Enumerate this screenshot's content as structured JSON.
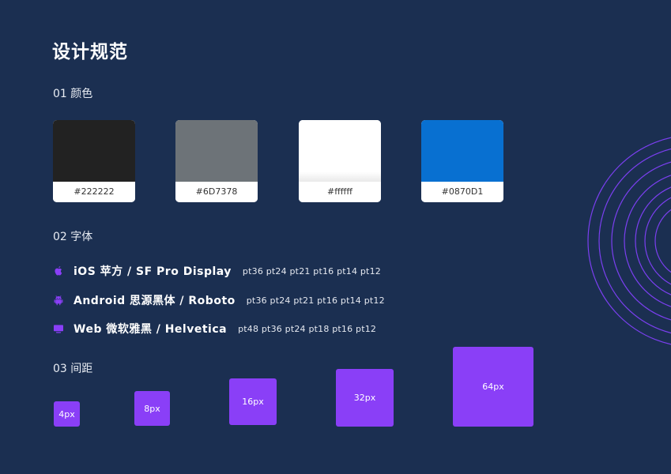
{
  "title": "设计规范",
  "sections": {
    "colors": "01 颜色",
    "fonts": "02 字体",
    "spacing": "03 间距"
  },
  "colors": [
    {
      "hex": "#222222",
      "label": "#222222"
    },
    {
      "hex": "#6D7378",
      "label": "#6D7378"
    },
    {
      "hex": "#ffffff",
      "label": "#ffffff"
    },
    {
      "hex": "#0870D1",
      "label": "#0870D1"
    }
  ],
  "fonts": [
    {
      "icon": "apple-icon",
      "name": "iOS  苹方 / SF Pro Display",
      "sizes": "pt36  pt24  pt21  pt16  pt14  pt12"
    },
    {
      "icon": "android-icon",
      "name": "Android  思源黑体 / Roboto",
      "sizes": "pt36  pt24  pt21  pt16  pt14  pt12"
    },
    {
      "icon": "monitor-icon",
      "name": "Web  微软雅黑 / Helvetica",
      "sizes": "pt48  pt36  pt24  pt18  pt16  pt12"
    }
  ],
  "spacing": [
    {
      "label": "4px"
    },
    {
      "label": "8px"
    },
    {
      "label": "16px"
    },
    {
      "label": "32px"
    },
    {
      "label": "64px"
    }
  ],
  "accent_color": "#8a3ff7",
  "background_color": "#1b2f51",
  "decoration_color": "#7b3ff0"
}
